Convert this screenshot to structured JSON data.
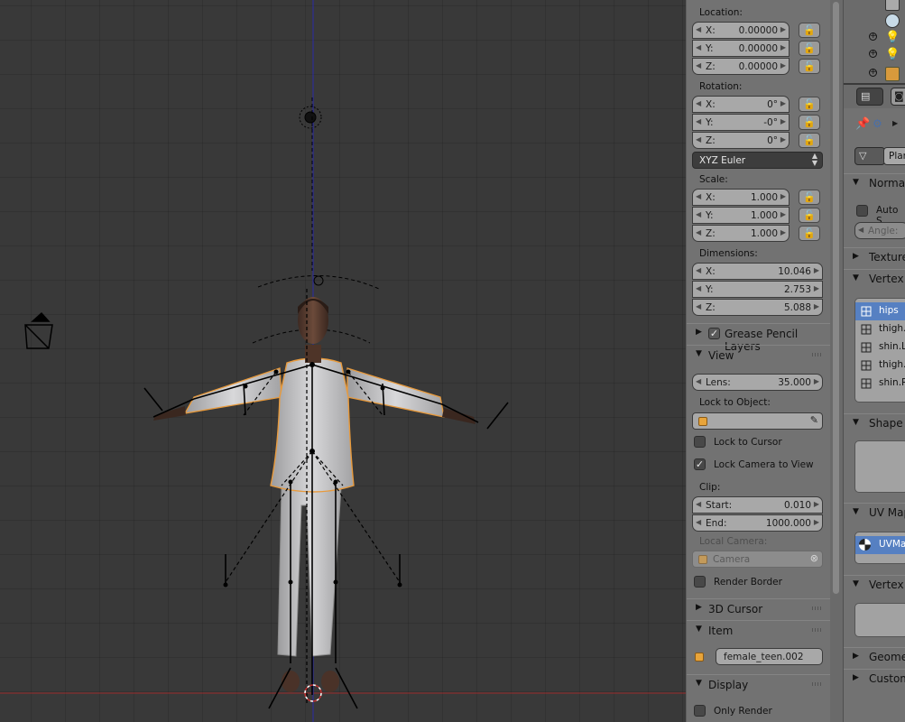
{
  "npanel": {
    "location_label": "Location:",
    "location": [
      {
        "axis": "X:",
        "value": "0.00000"
      },
      {
        "axis": "Y:",
        "value": "0.00000"
      },
      {
        "axis": "Z:",
        "value": "0.00000"
      }
    ],
    "rotation_label": "Rotation:",
    "rotation": [
      {
        "axis": "X:",
        "value": "0°"
      },
      {
        "axis": "Y:",
        "value": "-0°"
      },
      {
        "axis": "Z:",
        "value": "0°"
      }
    ],
    "rotation_mode": "XYZ Euler",
    "scale_label": "Scale:",
    "scale": [
      {
        "axis": "X:",
        "value": "1.000"
      },
      {
        "axis": "Y:",
        "value": "1.000"
      },
      {
        "axis": "Z:",
        "value": "1.000"
      }
    ],
    "dimensions_label": "Dimensions:",
    "dimensions": [
      {
        "axis": "X:",
        "value": "10.046"
      },
      {
        "axis": "Y:",
        "value": "2.753"
      },
      {
        "axis": "Z:",
        "value": "5.088"
      }
    ],
    "grease_pencil_label": "Grease Pencil Layers",
    "view": {
      "title": "View",
      "lens_label": "Lens:",
      "lens_value": "35.000",
      "lock_to_object_label": "Lock to Object:",
      "lock_to_cursor_label": "Lock to Cursor",
      "lock_to_cursor": false,
      "lock_camera_label": "Lock Camera to View",
      "lock_camera": true,
      "clip_label": "Clip:",
      "clip_start_label": "Start:",
      "clip_start": "0.010",
      "clip_end_label": "End:",
      "clip_end": "1000.000",
      "local_camera_label": "Local Camera:",
      "local_camera_placeholder": "Camera",
      "render_border_label": "Render Border",
      "render_border": false
    },
    "cursor_title": "3D Cursor",
    "item": {
      "title": "Item",
      "name": "female_teen.002"
    },
    "display": {
      "title": "Display",
      "only_render_label": "Only Render",
      "only_render": false
    }
  },
  "properties": {
    "object_data_name": "Plan",
    "normals_title": "Normal",
    "auto_smooth_label": "Auto S",
    "angle_label": "Angle:",
    "texture_title": "Texture",
    "vertex_groups_title": "Vertex",
    "vertex_groups": [
      {
        "name": "hips",
        "selected": true
      },
      {
        "name": "thigh.",
        "selected": false
      },
      {
        "name": "shin.L",
        "selected": false
      },
      {
        "name": "thigh.",
        "selected": false
      },
      {
        "name": "shin.R",
        "selected": false
      }
    ],
    "shape_keys_title": "Shape",
    "uv_maps_title": "UV Map",
    "uv_map_item": "UVMa",
    "vertex_colors_title": "Vertex",
    "geometry_title": "Geome",
    "custom_title": "Custom"
  },
  "colors": {
    "viewport_bg": "#393939",
    "panel_bg": "#727272",
    "selection": "#5680c2",
    "mesh_outline": "#e89a3c",
    "axis_x": "#9a2a2a",
    "axis_z": "#2a2aa8"
  }
}
